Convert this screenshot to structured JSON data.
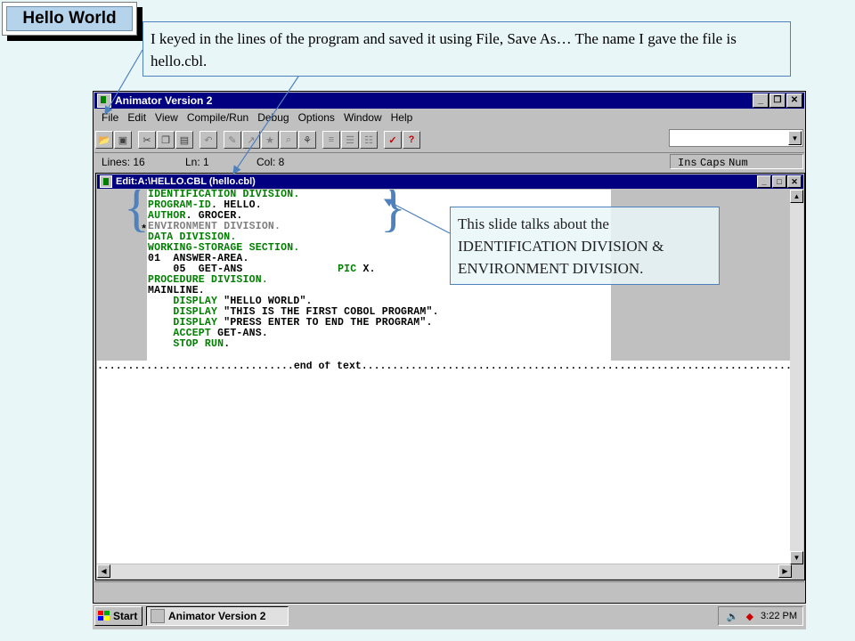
{
  "slide": {
    "title": "Hello World",
    "callout_top": "I keyed in the lines of the program and saved it using File, Save As…  The name I gave the file is hello.cbl.",
    "callout_right": "This slide talks about the IDENTIFICATION DIVISION & ENVIRONMENT DIVISION."
  },
  "app": {
    "title": "Animator Version 2",
    "menu": [
      "File",
      "Edit",
      "View",
      "Compile/Run",
      "Debug",
      "Options",
      "Window",
      "Help"
    ],
    "status": {
      "lines": "Lines: 16",
      "ln": "Ln: 1",
      "col": "Col: 8",
      "ins": "Ins",
      "caps": "Caps",
      "num": "Num"
    }
  },
  "editor": {
    "title": "Edit:A:\\HELLO.CBL (hello.cbl)",
    "lines": [
      {
        "kw": "IDENTIFICATION DIVISION.",
        "tx": ""
      },
      {
        "kw": "PROGRAM-ID",
        "tx": ". HELLO."
      },
      {
        "kw": "AUTHOR",
        "tx": ". GROCER."
      },
      {
        "cm": "ENVIRONMENT DIVISION."
      },
      {
        "kw": "DATA DIVISION.",
        "tx": ""
      },
      {
        "kw": "WORKING-STORAGE SECTION.",
        "tx": ""
      },
      {
        "tx": "01  ANSWER-AREA."
      },
      {
        "tx": "    05  GET-ANS",
        "kw2": "PIC",
        "tx2": " X."
      },
      {
        "kw": "PROCEDURE DIVISION.",
        "tx": ""
      },
      {
        "tx": "MAINLINE."
      },
      {
        "ind": "    ",
        "kw": "DISPLAY",
        "tx": " \"HELLO WORLD\"."
      },
      {
        "ind": "    ",
        "kw": "DISPLAY",
        "tx": " \"THIS IS THE FIRST COBOL PROGRAM\"."
      },
      {
        "ind": "    ",
        "kw": "DISPLAY",
        "tx": " \"PRESS ENTER TO END THE PROGRAM\"."
      },
      {
        "ind": "    ",
        "kw": "ACCEPT",
        "tx": " GET-ANS."
      },
      {
        "ind": "    ",
        "kw": "STOP RUN",
        "tx": "."
      }
    ],
    "comment_marker": "*",
    "eot_label": "end of text"
  },
  "taskbar": {
    "start": "Start",
    "task": "Animator Version 2",
    "clock": "3:22 PM"
  }
}
